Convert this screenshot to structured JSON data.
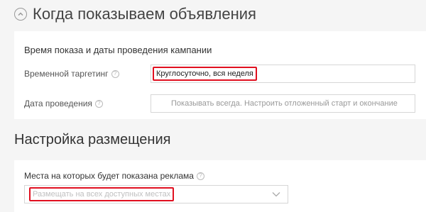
{
  "section1": {
    "title": "Когда показываем объявления",
    "subtitle": "Время показа и даты проведения кампании",
    "targeting": {
      "label": "Временной таргетинг",
      "value": "Круглосуточно, вся неделя"
    },
    "dates": {
      "label": "Дата проведения",
      "placeholder": "Показывать всегда. Настроить отложенный старт и окончание"
    }
  },
  "section2": {
    "title": "Настройка размещения",
    "placements": {
      "label": "Места на которых будет показана реклама",
      "selected": "Размещать на всех доступных местах"
    }
  },
  "icons": {
    "help_glyph": "?"
  },
  "colors": {
    "highlight": "#e01020",
    "background": "#f5f5f5",
    "card": "#ffffff"
  }
}
